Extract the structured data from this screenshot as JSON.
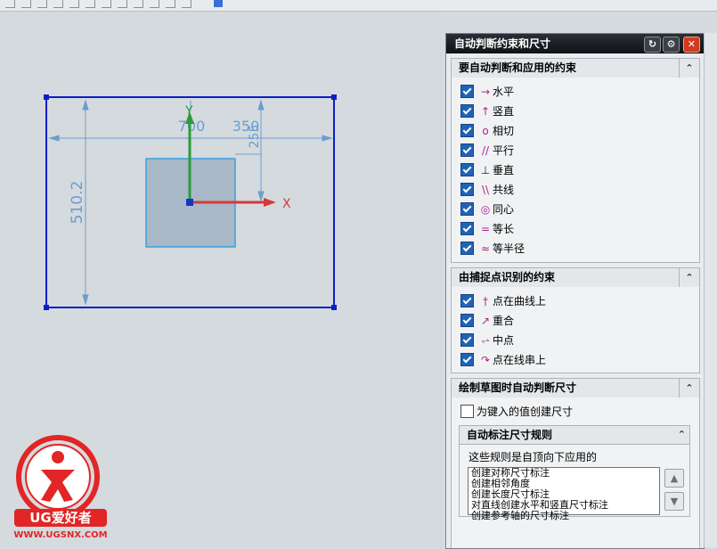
{
  "canvas": {
    "dim_height": "510.2",
    "dim_top_left": "700",
    "dim_top_right": "350",
    "dim_vertical_small": "255",
    "axis_x": "X",
    "axis_y": "Y"
  },
  "logo": {
    "brand": "UG爱好者",
    "url": "WWW.UGSNX.COM"
  },
  "panel": {
    "title": "自动判断约束和尺寸",
    "refresh_icon": "reset-icon",
    "settings_icon": "gear-icon",
    "close_icon": "close-icon",
    "section1": {
      "title": "要自动判断和应用的约束",
      "items": [
        {
          "label": "水平",
          "checked": true
        },
        {
          "label": "竖直",
          "checked": true
        },
        {
          "label": "相切",
          "checked": true
        },
        {
          "label": "平行",
          "checked": true
        },
        {
          "label": "垂直",
          "checked": true
        },
        {
          "label": "共线",
          "checked": true
        },
        {
          "label": "同心",
          "checked": true
        },
        {
          "label": "等长",
          "checked": true
        },
        {
          "label": "等半径",
          "checked": true
        }
      ]
    },
    "section2": {
      "title": "由捕捉点识别的约束",
      "items": [
        {
          "label": "点在曲线上",
          "checked": true
        },
        {
          "label": "重合",
          "checked": true
        },
        {
          "label": "中点",
          "checked": true
        },
        {
          "label": "点在线串上",
          "checked": true
        }
      ]
    },
    "section3": {
      "title": "绘制草图时自动判断尺寸",
      "typed_value_option": {
        "label": "为键入的值创建尺寸",
        "checked": false
      },
      "rules": {
        "title": "自动标注尺寸规则",
        "note": "这些规则是自顶向下应用的",
        "list": [
          "创建对称尺寸标注",
          "创建相邻角度",
          "创建长度尺寸标注",
          "对直线创建水平和竖直尺寸标注",
          "创建参考轴的尺寸标注"
        ]
      }
    }
  }
}
